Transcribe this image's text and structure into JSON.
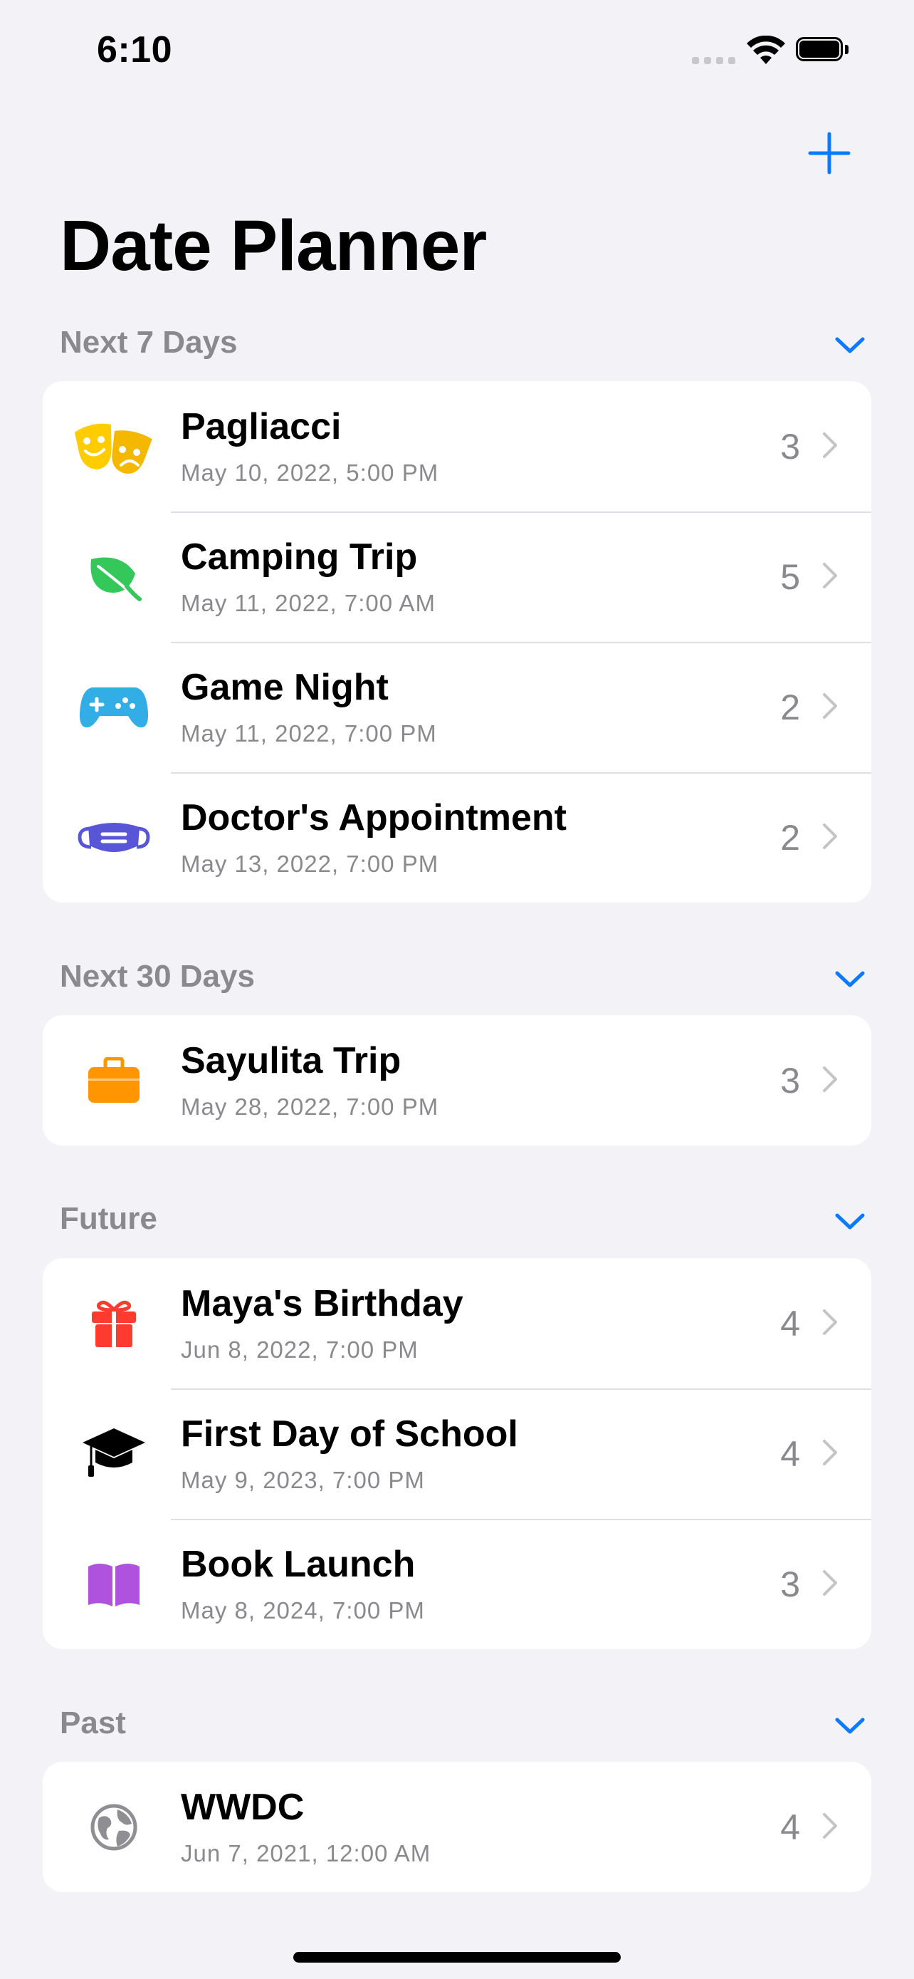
{
  "status_bar": {
    "time": "6:10"
  },
  "app": {
    "title": "Date Planner",
    "accent_color": "#0A7AFF"
  },
  "sections": [
    {
      "title": "Next 7 Days",
      "events": [
        {
          "title": "Pagliacci",
          "date": "May 10, 2022, 5:00 PM",
          "count": "3",
          "icon": "theater-masks-icon",
          "icon_color": "#FFCC00"
        },
        {
          "title": "Camping Trip",
          "date": "May 11, 2022, 7:00 AM",
          "count": "5",
          "icon": "leaf-icon",
          "icon_color": "#34C759"
        },
        {
          "title": "Game Night",
          "date": "May 11, 2022, 7:00 PM",
          "count": "2",
          "icon": "game-controller-icon",
          "icon_color": "#32ADE6"
        },
        {
          "title": "Doctor's Appointment",
          "date": "May 13, 2022, 7:00 PM",
          "count": "2",
          "icon": "face-mask-icon",
          "icon_color": "#5856D6"
        }
      ]
    },
    {
      "title": "Next 30 Days",
      "events": [
        {
          "title": "Sayulita Trip",
          "date": "May 28, 2022, 7:00 PM",
          "count": "3",
          "icon": "suitcase-icon",
          "icon_color": "#FF9500"
        }
      ]
    },
    {
      "title": "Future",
      "events": [
        {
          "title": "Maya's Birthday",
          "date": "Jun 8, 2022, 7:00 PM",
          "count": "4",
          "icon": "gift-icon",
          "icon_color": "#FF3B30"
        },
        {
          "title": "First Day of School",
          "date": "May 9, 2023, 7:00 PM",
          "count": "4",
          "icon": "graduation-cap-icon",
          "icon_color": "#000000"
        },
        {
          "title": "Book Launch",
          "date": "May 8, 2024, 7:00 PM",
          "count": "3",
          "icon": "open-book-icon",
          "icon_color": "#AF52DE"
        }
      ]
    },
    {
      "title": "Past",
      "events": [
        {
          "title": "WWDC",
          "date": "Jun 7, 2021, 12:00 AM",
          "count": "4",
          "icon": "globe-icon",
          "icon_color": "#8E8E93"
        }
      ]
    }
  ]
}
